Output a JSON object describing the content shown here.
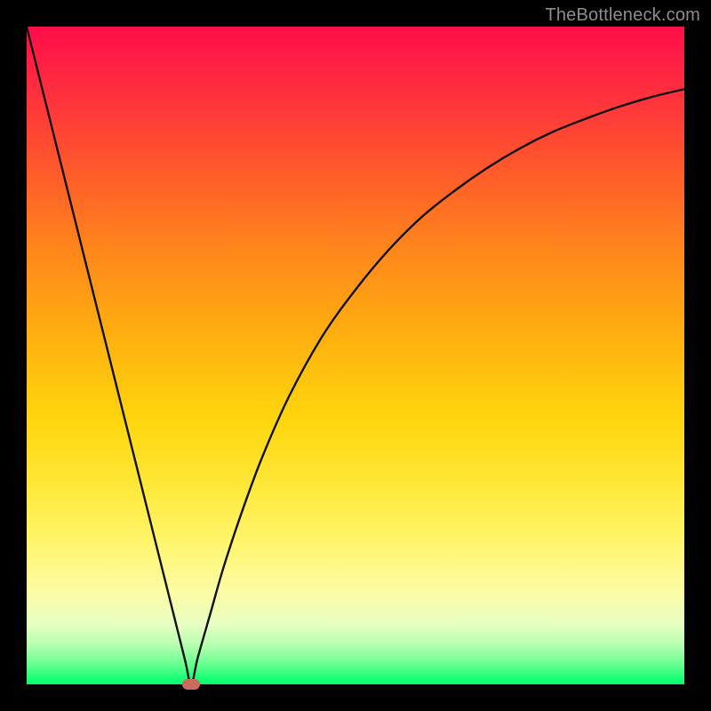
{
  "watermark": "TheBottleneck.com",
  "colors": {
    "frame": "#000000",
    "marker": "#cb6a5e",
    "curve": "#111111",
    "gradient_top": "#ff0d4a",
    "gradient_bottom": "#00ff6c"
  },
  "chart_data": {
    "type": "line",
    "title": "",
    "xlabel": "",
    "ylabel": "",
    "xlim": [
      0,
      100
    ],
    "ylim": [
      0,
      100
    ],
    "grid": false,
    "legend": false,
    "annotations": [
      {
        "type": "marker",
        "x": 25,
        "y": 0
      }
    ],
    "series": [
      {
        "name": "bottleneck-curve",
        "x": [
          0,
          3,
          6,
          9,
          12,
          15,
          18,
          21,
          24,
          25,
          26,
          28,
          30,
          33,
          36,
          40,
          45,
          50,
          55,
          60,
          65,
          70,
          75,
          80,
          85,
          90,
          95,
          100
        ],
        "y": [
          100,
          88,
          76,
          64,
          52,
          40,
          28,
          16,
          4,
          0,
          4,
          11,
          18,
          27,
          35,
          44,
          53,
          60,
          66,
          71,
          75,
          78.5,
          81.5,
          84,
          86,
          87.8,
          89.3,
          90.5
        ]
      }
    ]
  }
}
